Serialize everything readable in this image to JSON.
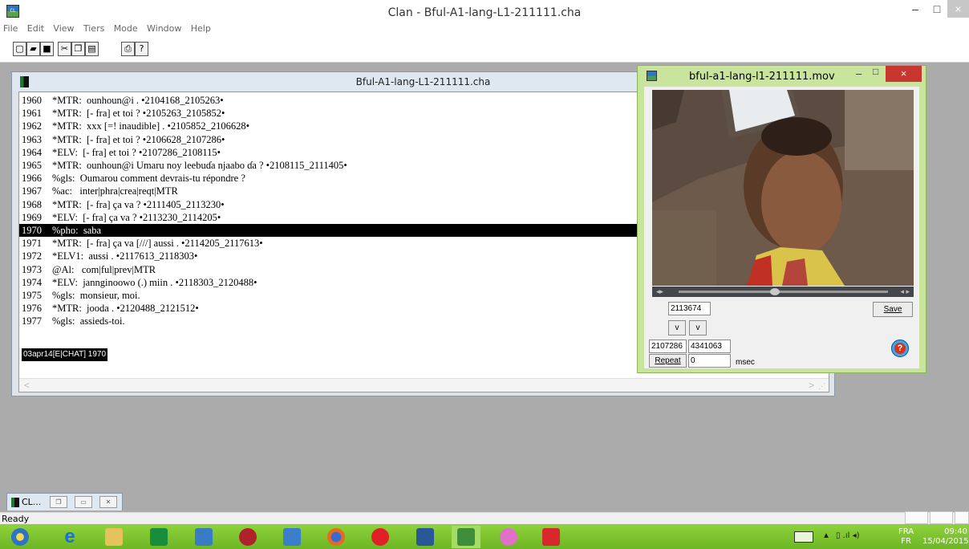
{
  "window": {
    "title": "Clan - Bful-A1-lang-L1-211111.cha",
    "minimize": "–",
    "maximize": "□",
    "close": "×"
  },
  "menu": [
    "File",
    "Edit",
    "View",
    "Tiers",
    "Mode",
    "Window",
    "Help"
  ],
  "toolbar": {
    "icons": [
      "new-file-icon",
      "open-folder-icon",
      "save-icon",
      "cut-icon",
      "copy-icon",
      "paste-icon",
      "print-icon",
      "help-icon"
    ]
  },
  "document": {
    "title": "Bful-A1-lang-L1-211111.cha",
    "lines": [
      {
        "num": "1960",
        "text": "*MTR:  ounhoun@i . •2104168_2105263•"
      },
      {
        "num": "1961",
        "text": "*MTR:  [- fra] et toi ? •2105263_2105852•"
      },
      {
        "num": "1962",
        "text": "*MTR:  xxx [=! inaudible] . •2105852_2106628•"
      },
      {
        "num": "1963",
        "text": "*MTR:  [- fra] et toi ? •2106628_2107286•"
      },
      {
        "num": "1964",
        "text": "*ELV:  [- fra] et toi ? •2107286_2108115•"
      },
      {
        "num": "1965",
        "text": "*MTR:  ounhoun@i Umaru noy leebuɗa njaabo ɗa ? •2108115_2111405•"
      },
      {
        "num": "1966",
        "text": "%gls:  Oumarou comment devrais-tu répondre ?"
      },
      {
        "num": "1967",
        "text": "%ac:   inter|phra|crea|reqt|MTR"
      },
      {
        "num": "1968",
        "text": "*MTR:  [- fra] ça va ? •2111405_2113230•"
      },
      {
        "num": "1969",
        "text": "*ELV:  [- fra] ça va ? •2113230_2114205•"
      },
      {
        "num": "1970",
        "text": "%pho:  saba",
        "selected": true
      },
      {
        "num": "1971",
        "text": "*MTR:  [- fra] ça va [///] aussi . •2114205_2117613•"
      },
      {
        "num": "1972",
        "text": "*ELV1:  aussi . •2117613_2118303•"
      },
      {
        "num": "1973",
        "text": "@Al:   com|ful|prev|MTR"
      },
      {
        "num": "1974",
        "text": "*ELV:  jannginoowo (.) miin . •2118303_2120488•"
      },
      {
        "num": "1975",
        "text": "%gls:  monsieur, moi."
      },
      {
        "num": "1976",
        "text": "*MTR:  jooda . •2120488_2121512•"
      },
      {
        "num": "1977",
        "text": "%gls:  assieds-toi."
      }
    ],
    "status_line": "03apr14[E|CHAT]   1970",
    "scroll_left": "<",
    "scroll_right": ">"
  },
  "video_window": {
    "title": "bful-a1-lang-l1-211111.mov",
    "minimize": "–",
    "maximize": "□",
    "close": "×",
    "current_position": "2113674",
    "save_label": "Save",
    "v_label": "v",
    "start_time": "2107286",
    "end_time": "4341063",
    "repeat_label": "Repeat",
    "repeat_value": "0",
    "msec_label": "msec",
    "help_label": "?",
    "playback_position": 0.46
  },
  "minimized_child": {
    "label": "CL..."
  },
  "statusbar": {
    "text": "Ready"
  },
  "taskbar": {
    "apps": [
      "start-orb",
      "internet-explorer-icon",
      "file-explorer-icon",
      "store-icon",
      "remote-desktop-icon",
      "media-app-icon",
      "network-app-icon",
      "firefox-icon",
      "opera-icon",
      "word-icon",
      "clan-icon",
      "paint-icon",
      "acrobat-icon"
    ],
    "language_top": "FRA",
    "language_bottom": "FR",
    "time": "09:40",
    "date": "15/04/2015"
  },
  "colors": {
    "video_frame": "#c9e59d",
    "taskbar": "#7cc22f",
    "selection": "#000000"
  }
}
